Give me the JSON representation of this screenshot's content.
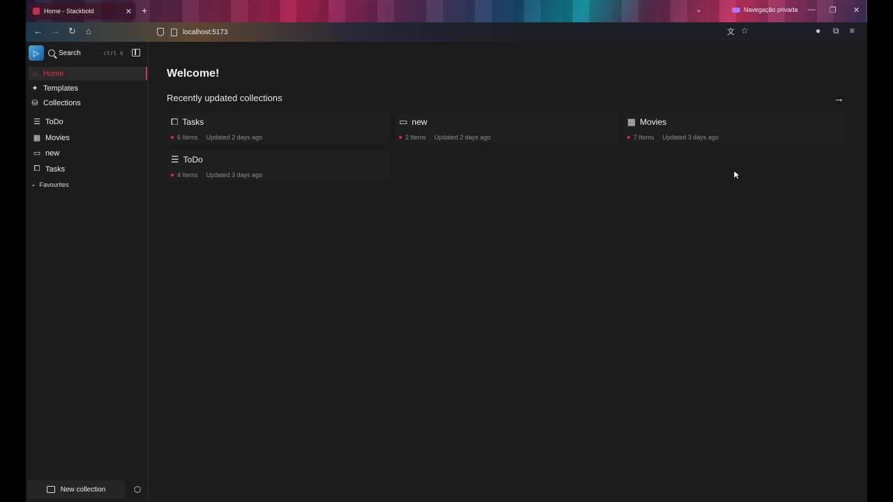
{
  "browser": {
    "tab_title": "Home - Stackbold",
    "private_label": "Navegação privada",
    "url": "localhost:5173"
  },
  "sidebar": {
    "search_label": "Search",
    "search_shortcut": "ctrl k",
    "nav": [
      {
        "label": "Home",
        "icon": "home-icon",
        "active": true
      },
      {
        "label": "Templates",
        "icon": "sparkle-icon"
      },
      {
        "label": "Collections",
        "icon": "database-icon"
      }
    ],
    "collections": [
      {
        "label": "ToDo",
        "icon": "checklist-icon"
      },
      {
        "label": "Movies",
        "icon": "film-icon"
      },
      {
        "label": "new",
        "icon": "folder-icon"
      },
      {
        "label": "Tasks",
        "icon": "book-icon"
      }
    ],
    "favourites_label": "Favourites",
    "new_collection_label": "New collection"
  },
  "main": {
    "welcome": "Welcome!",
    "section_title": "Recently updated collections",
    "cards": [
      {
        "title": "Tasks",
        "icon": "book-icon",
        "count": "6 Items",
        "updated": "Updated 2 days ago"
      },
      {
        "title": "new",
        "icon": "folder-icon",
        "count": "2 Items",
        "updated": "Updated 2 days ago"
      },
      {
        "title": "Movies",
        "icon": "film-icon",
        "count": "7 Items",
        "updated": "Updated 3 days ago"
      },
      {
        "title": "ToDo",
        "icon": "checklist-icon",
        "count": "4 Items",
        "updated": "Updated 3 days ago"
      }
    ]
  },
  "colors": {
    "accent": "#e0304a",
    "background": "#1b1b1b"
  }
}
